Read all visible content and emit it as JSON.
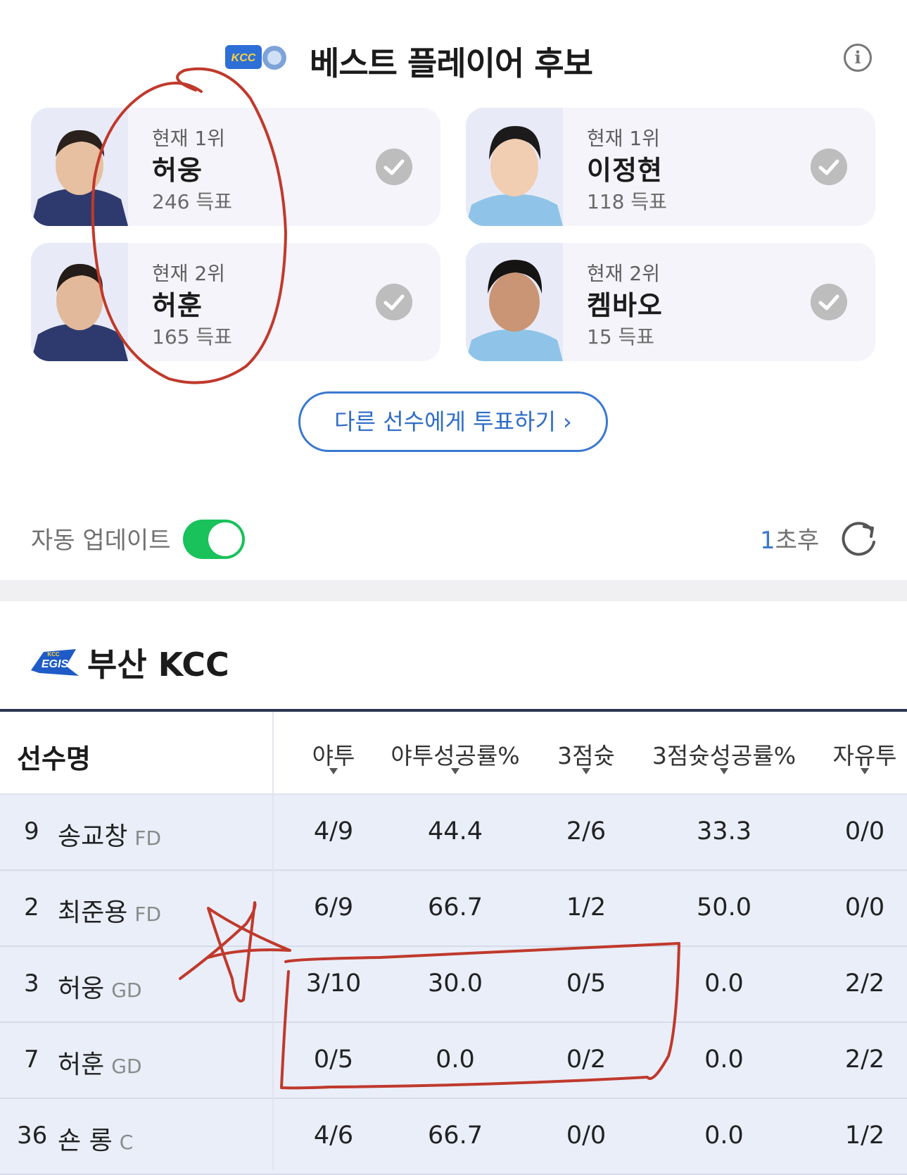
{
  "best_player": {
    "title": "베스트 플레이어 후보",
    "info_icon": "info-icon",
    "candidates": [
      {
        "rank": "현재 1위",
        "name": "허웅",
        "votes": "246 득표"
      },
      {
        "rank": "현재 1위",
        "name": "이정현",
        "votes": "118 득표"
      },
      {
        "rank": "현재 2위",
        "name": "허훈",
        "votes": "165 득표"
      },
      {
        "rank": "현재 2위",
        "name": "켐바오",
        "votes": "15 득표"
      }
    ],
    "vote_button": "다른 선수에게 투표하기 ›"
  },
  "auto_update": {
    "label": "자동 업데이트",
    "enabled": true,
    "countdown_number": "1",
    "countdown_suffix": "초후",
    "refresh_icon": "refresh-icon"
  },
  "team": {
    "name": "부산 KCC",
    "columns": {
      "name": "선수명",
      "fg": "야투",
      "fg_pct": "야투성공률%",
      "three": "3점슛",
      "three_pct": "3점슛성공률%",
      "ft": "자유투"
    },
    "rows": [
      {
        "num": "9",
        "name": "송교창",
        "pos": "FD",
        "fg": "4/9",
        "fg_pct": "44.4",
        "three": "2/6",
        "three_pct": "33.3",
        "ft": "0/0"
      },
      {
        "num": "2",
        "name": "최준용",
        "pos": "FD",
        "fg": "6/9",
        "fg_pct": "66.7",
        "three": "1/2",
        "three_pct": "50.0",
        "ft": "0/0"
      },
      {
        "num": "3",
        "name": "허웅",
        "pos": "GD",
        "fg": "3/10",
        "fg_pct": "30.0",
        "three": "0/5",
        "three_pct": "0.0",
        "ft": "2/2"
      },
      {
        "num": "7",
        "name": "허훈",
        "pos": "GD",
        "fg": "0/5",
        "fg_pct": "0.0",
        "three": "0/2",
        "three_pct": "0.0",
        "ft": "2/2"
      },
      {
        "num": "36",
        "name": "숀 롱",
        "pos": "C",
        "fg": "4/6",
        "fg_pct": "66.7",
        "three": "0/0",
        "three_pct": "0.0",
        "ft": "1/2"
      }
    ]
  },
  "colors": {
    "accent_blue": "#3a78d0",
    "toggle_green": "#19c25a",
    "annotation_red": "#c0392b",
    "row_bg": "#e9eef9"
  }
}
